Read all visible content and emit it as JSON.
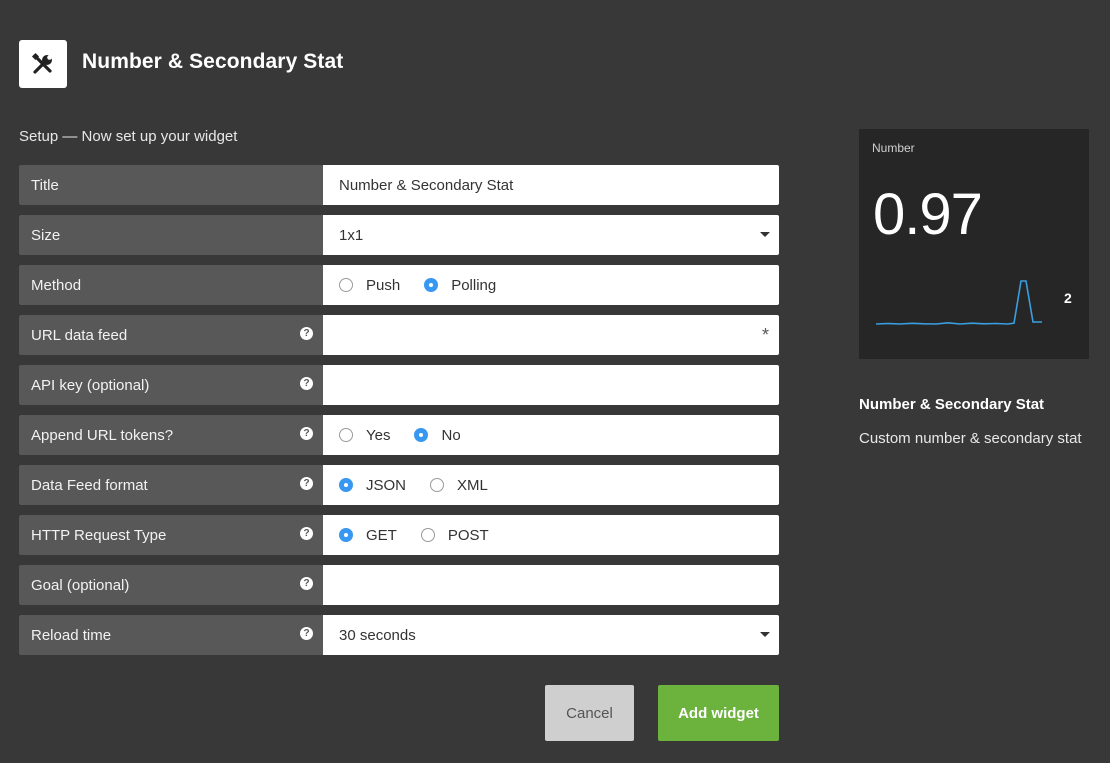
{
  "header": {
    "title": "Number & Secondary Stat",
    "icon": "tools-icon"
  },
  "setup_label": "Setup — Now set up your widget",
  "form": {
    "title": {
      "label": "Title",
      "value": "Number & Secondary Stat"
    },
    "size": {
      "label": "Size",
      "value": "1x1"
    },
    "method": {
      "label": "Method",
      "options": [
        "Push",
        "Polling"
      ],
      "selected": "Polling"
    },
    "url_data_feed": {
      "label": "URL data feed",
      "value": "",
      "required_mark": "*"
    },
    "api_key": {
      "label": "API key (optional)",
      "value": ""
    },
    "append_url_tokens": {
      "label": "Append URL tokens?",
      "options": [
        "Yes",
        "No"
      ],
      "selected": "No"
    },
    "data_feed_format": {
      "label": "Data Feed format",
      "options": [
        "JSON",
        "XML"
      ],
      "selected": "JSON"
    },
    "http_request_type": {
      "label": "HTTP Request Type",
      "options": [
        "GET",
        "POST"
      ],
      "selected": "GET"
    },
    "goal": {
      "label": "Goal (optional)",
      "value": ""
    },
    "reload_time": {
      "label": "Reload time",
      "value": "30 seconds"
    },
    "help_glyph": "?"
  },
  "buttons": {
    "cancel": "Cancel",
    "add": "Add widget"
  },
  "preview": {
    "label": "Number",
    "value": "0.97",
    "secondary": "2",
    "sparkline_color": "#3a9fe0"
  },
  "widget_info": {
    "name": "Number & Secondary Stat",
    "description": "Custom number & secondary stat"
  },
  "colors": {
    "background": "#383838",
    "label_bg": "#585858",
    "radio_checked": "#3897f0",
    "add_button": "#6cb33e",
    "cancel_button": "#cfcfcf",
    "preview_bg": "#262626"
  }
}
